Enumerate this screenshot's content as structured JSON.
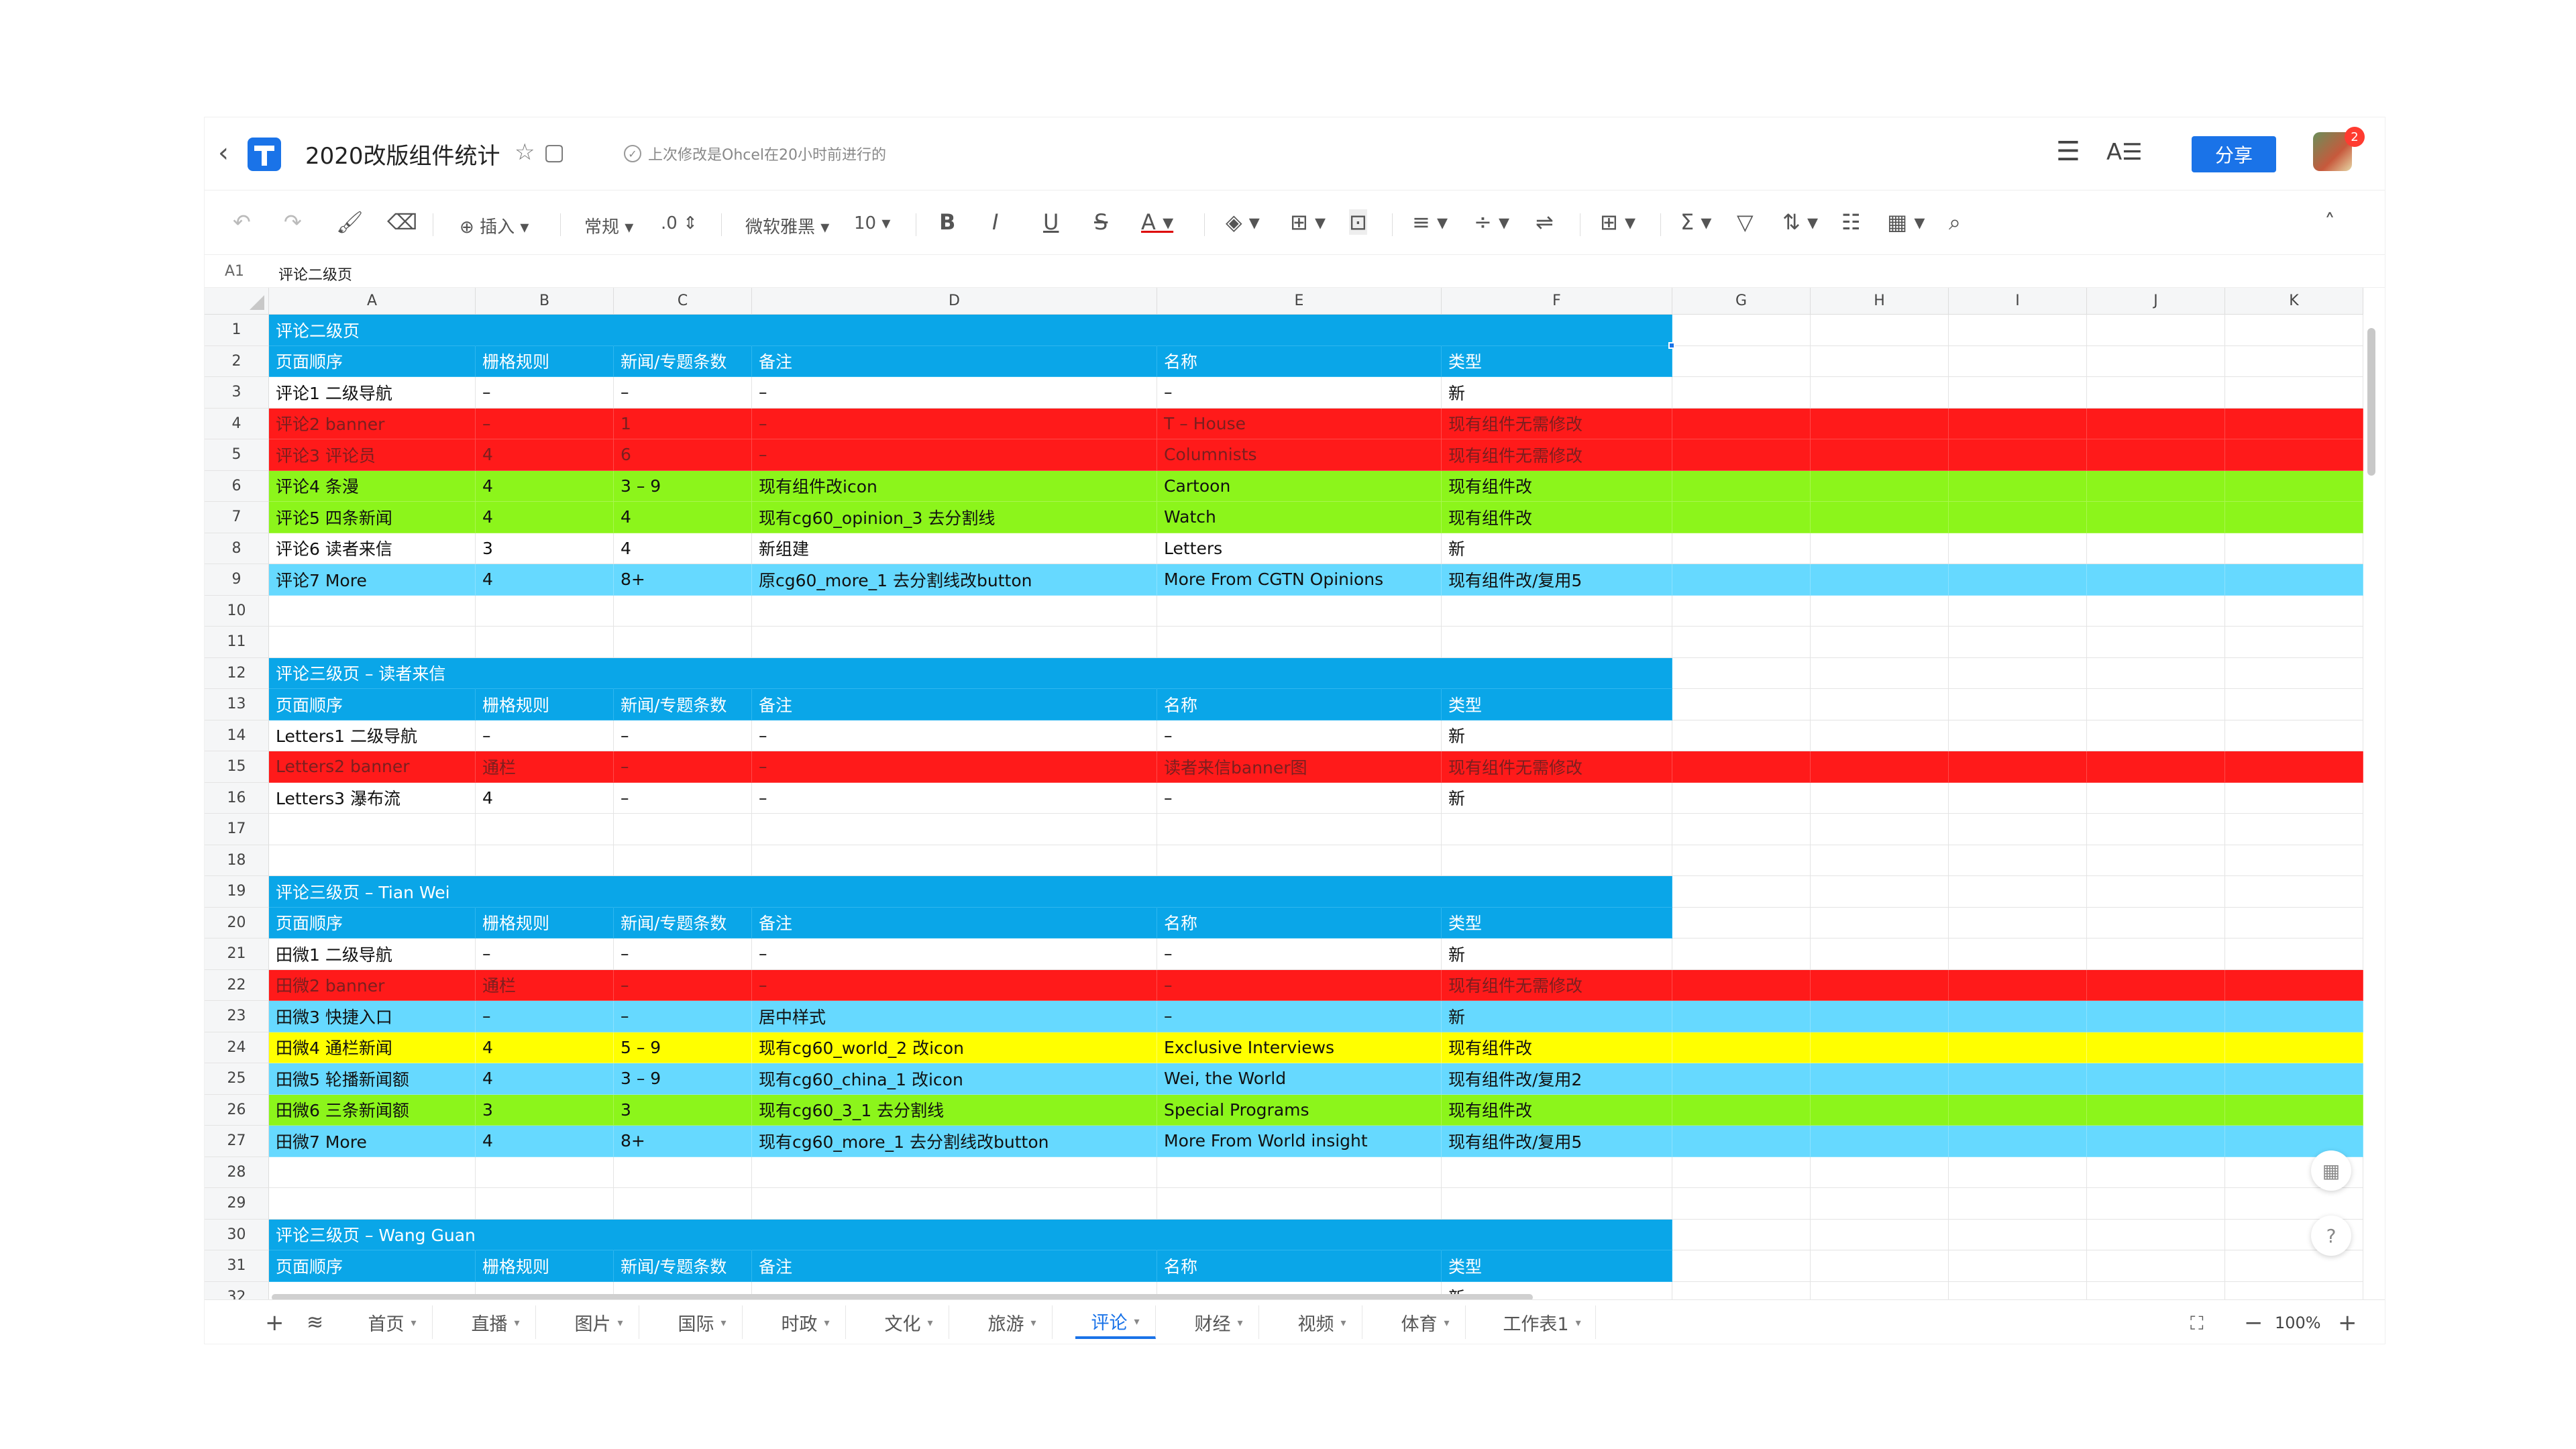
{
  "app": {
    "title": "2020改版组件统计",
    "save_status": "上次修改是Ohcel在20小时前进行的",
    "share_label": "分享",
    "notification_count": "2"
  },
  "toolbar": {
    "insert_label": "插入",
    "format_label": "常规",
    "decimal_label": ".0",
    "font_label": "微软雅黑",
    "size_label": "10"
  },
  "formula": {
    "cell_ref": "A1",
    "value": "评论二级页"
  },
  "columns": [
    "A",
    "B",
    "C",
    "D",
    "E",
    "F",
    "G",
    "H",
    "I",
    "J",
    "K"
  ],
  "rows": [
    {
      "n": "1",
      "style": "blue",
      "cells": [
        "评论二级页",
        "",
        "",
        "",
        "",
        ""
      ]
    },
    {
      "n": "2",
      "style": "header",
      "cells": [
        "页面顺序",
        "栅格规则",
        "新闻/专题条数",
        "备注",
        "名称",
        "类型"
      ]
    },
    {
      "n": "3",
      "style": "plain",
      "cells": [
        "评论1 二级导航",
        "–",
        "–",
        "–",
        "–",
        "新"
      ]
    },
    {
      "n": "4",
      "style": "red",
      "cells": [
        "评论2 banner",
        "–",
        "1",
        "–",
        "T – House",
        "现有组件无需修改"
      ]
    },
    {
      "n": "5",
      "style": "red",
      "cells": [
        "评论3 评论员",
        "4",
        "6",
        "–",
        "Columnists",
        "现有组件无需修改"
      ]
    },
    {
      "n": "6",
      "style": "green",
      "cells": [
        "评论4 条漫",
        "4",
        "3 – 9",
        "现有组件改icon",
        "Cartoon",
        "现有组件改"
      ]
    },
    {
      "n": "7",
      "style": "green",
      "cells": [
        "评论5 四条新闻",
        "4",
        "4",
        "现有cg60_opinion_3 去分割线",
        "Watch",
        "现有组件改"
      ]
    },
    {
      "n": "8",
      "style": "plain",
      "cells": [
        "评论6 读者来信",
        "3",
        "4",
        "新组建",
        "Letters",
        "新"
      ]
    },
    {
      "n": "9",
      "style": "cyan",
      "cells": [
        "评论7 More",
        "4",
        "8+",
        "原cg60_more_1 去分割线改button",
        "More From CGTN Opinions",
        "现有组件改/复用5"
      ]
    },
    {
      "n": "10",
      "style": "plain",
      "cells": [
        "",
        "",
        "",
        "",
        "",
        ""
      ]
    },
    {
      "n": "11",
      "style": "plain",
      "cells": [
        "",
        "",
        "",
        "",
        "",
        ""
      ]
    },
    {
      "n": "12",
      "style": "blue",
      "cells": [
        "评论三级页 – 读者来信",
        "",
        "",
        "",
        "",
        ""
      ]
    },
    {
      "n": "13",
      "style": "header",
      "cells": [
        "页面顺序",
        "栅格规则",
        "新闻/专题条数",
        "备注",
        "名称",
        "类型"
      ]
    },
    {
      "n": "14",
      "style": "plain",
      "cells": [
        "Letters1 二级导航",
        "–",
        "–",
        "–",
        "–",
        "新"
      ]
    },
    {
      "n": "15",
      "style": "red",
      "cells": [
        "Letters2 banner",
        "通栏",
        "–",
        "–",
        "读者来信banner图",
        "现有组件无需修改"
      ]
    },
    {
      "n": "16",
      "style": "plain",
      "cells": [
        "Letters3 瀑布流",
        "4",
        "–",
        "–",
        "–",
        "新"
      ]
    },
    {
      "n": "17",
      "style": "plain",
      "cells": [
        "",
        "",
        "",
        "",
        "",
        ""
      ]
    },
    {
      "n": "18",
      "style": "plain",
      "cells": [
        "",
        "",
        "",
        "",
        "",
        ""
      ]
    },
    {
      "n": "19",
      "style": "blue",
      "cells": [
        "评论三级页 – Tian Wei",
        "",
        "",
        "",
        "",
        ""
      ]
    },
    {
      "n": "20",
      "style": "header",
      "cells": [
        "页面顺序",
        "栅格规则",
        "新闻/专题条数",
        "备注",
        "名称",
        "类型"
      ]
    },
    {
      "n": "21",
      "style": "plain",
      "cells": [
        "田微1 二级导航",
        "–",
        "–",
        "–",
        "–",
        "新"
      ]
    },
    {
      "n": "22",
      "style": "red",
      "cells": [
        "田微2 banner",
        "通栏",
        "–",
        "–",
        "–",
        "现有组件无需修改"
      ]
    },
    {
      "n": "23",
      "style": "cyan",
      "cells": [
        "田微3 快捷入口",
        "–",
        "–",
        "居中样式",
        "–",
        "新"
      ]
    },
    {
      "n": "24",
      "style": "yellow",
      "cells": [
        "田微4 通栏新闻",
        "4",
        "5 – 9",
        "现有cg60_world_2 改icon",
        "Exclusive Interviews",
        "现有组件改"
      ]
    },
    {
      "n": "25",
      "style": "cyan",
      "cells": [
        "田微5 轮播新闻额",
        "4",
        "3 – 9",
        "现有cg60_china_1 改icon",
        "Wei, the World",
        "现有组件改/复用2"
      ]
    },
    {
      "n": "26",
      "style": "green",
      "cells": [
        "田微6 三条新闻额",
        "3",
        "3",
        "现有cg60_3_1 去分割线",
        "Special Programs",
        "现有组件改"
      ]
    },
    {
      "n": "27",
      "style": "cyan",
      "cells": [
        "田微7 More",
        "4",
        "8+",
        "现有cg60_more_1 去分割线改button",
        "More From World insight",
        "现有组件改/复用5"
      ]
    },
    {
      "n": "28",
      "style": "plain",
      "cells": [
        "",
        "",
        "",
        "",
        "",
        ""
      ]
    },
    {
      "n": "29",
      "style": "plain",
      "cells": [
        "",
        "",
        "",
        "",
        "",
        ""
      ]
    },
    {
      "n": "30",
      "style": "blue",
      "cells": [
        "评论三级页 – Wang Guan",
        "",
        "",
        "",
        "",
        ""
      ]
    },
    {
      "n": "31",
      "style": "header",
      "cells": [
        "页面顺序",
        "栅格规则",
        "新闻/专题条数",
        "备注",
        "名称",
        "类型"
      ]
    },
    {
      "n": "32",
      "style": "plain",
      "cells": [
        "",
        "",
        "",
        "",
        "",
        "新"
      ]
    }
  ],
  "sheet_tabs": [
    "首页",
    "直播",
    "图片",
    "国际",
    "时政",
    "文化",
    "旅游",
    "评论",
    "财经",
    "视频",
    "体育",
    "工作表1"
  ],
  "active_tab": "评论",
  "zoom": "100%",
  "colors": {
    "blue": "#0aa6e8",
    "red": "#ff1a1a",
    "green": "#8cf51b",
    "cyan": "#66d9ff",
    "yellow": "#ffff00",
    "accent": "#1a73e8"
  }
}
